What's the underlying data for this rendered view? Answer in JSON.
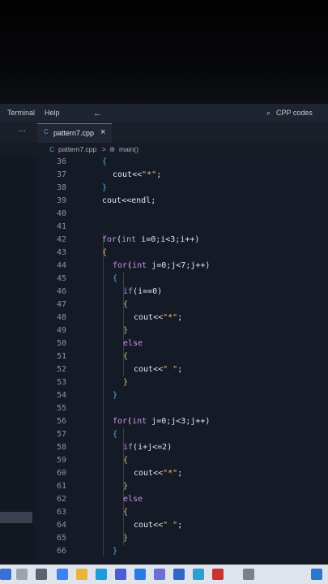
{
  "menu": {
    "terminal": "Terminal",
    "help": "Help",
    "back": "←",
    "search_icon": "⌕",
    "title": "CPP codes"
  },
  "tab": {
    "icon": "C",
    "name": "pattern7.cpp",
    "close": "×",
    "more": "···"
  },
  "breadcrumb": {
    "icon": "C",
    "file": "pattern7.cpp",
    "sep": ">",
    "fn_icon": "⊛",
    "fn": "main()"
  },
  "colors": {
    "keyword": "#c792ea",
    "brace_gold": "#e5c07b",
    "brace_blue": "#5aa9e6",
    "string": "#e5c07b",
    "text": "#e2e6ec",
    "line_number": "#8a93a2",
    "accent": "#3b82f6"
  },
  "lines": [
    {
      "num": "36",
      "indent": 2,
      "tokens": [
        {
          "t": "{",
          "c": "bb"
        }
      ]
    },
    {
      "num": "37",
      "indent": 3,
      "tokens": [
        {
          "t": "cout<<",
          "c": "w"
        },
        {
          "t": "\"*\"",
          "c": "s"
        },
        {
          "t": ";",
          "c": "w"
        }
      ]
    },
    {
      "num": "38",
      "indent": 2,
      "tokens": [
        {
          "t": "}",
          "c": "bb"
        }
      ]
    },
    {
      "num": "39",
      "indent": 2,
      "tokens": [
        {
          "t": "cout<<endl;",
          "c": "w"
        }
      ]
    },
    {
      "num": "40",
      "indent": 0,
      "tokens": []
    },
    {
      "num": "41",
      "indent": 0,
      "tokens": []
    },
    {
      "num": "42",
      "indent": 2,
      "tokens": [
        {
          "t": "for",
          "c": "k"
        },
        {
          "t": "(",
          "c": "w"
        },
        {
          "t": "int",
          "c": "k"
        },
        {
          "t": " i=0;i<3;i++)",
          "c": "w"
        }
      ]
    },
    {
      "num": "43",
      "indent": 2,
      "tokens": [
        {
          "t": "{",
          "c": "by"
        }
      ]
    },
    {
      "num": "44",
      "indent": 3,
      "tokens": [
        {
          "t": "for",
          "c": "k"
        },
        {
          "t": "(",
          "c": "w"
        },
        {
          "t": "int",
          "c": "k"
        },
        {
          "t": " j=0;j<7;j++)",
          "c": "w"
        }
      ]
    },
    {
      "num": "45",
      "indent": 3,
      "tokens": [
        {
          "t": "{",
          "c": "bb"
        }
      ]
    },
    {
      "num": "46",
      "indent": 4,
      "tokens": [
        {
          "t": "if",
          "c": "k"
        },
        {
          "t": "(i==0)",
          "c": "w"
        }
      ]
    },
    {
      "num": "47",
      "indent": 4,
      "tokens": [
        {
          "t": "{",
          "c": "by"
        }
      ]
    },
    {
      "num": "48",
      "indent": 5,
      "tokens": [
        {
          "t": "cout<<",
          "c": "w"
        },
        {
          "t": "\"*\"",
          "c": "s"
        },
        {
          "t": ";",
          "c": "w"
        }
      ]
    },
    {
      "num": "49",
      "indent": 4,
      "tokens": [
        {
          "t": "}",
          "c": "by"
        }
      ]
    },
    {
      "num": "50",
      "indent": 4,
      "tokens": [
        {
          "t": "else",
          "c": "k"
        }
      ]
    },
    {
      "num": "51",
      "indent": 4,
      "tokens": [
        {
          "t": "{",
          "c": "by"
        }
      ]
    },
    {
      "num": "52",
      "indent": 5,
      "tokens": [
        {
          "t": "cout<<",
          "c": "w"
        },
        {
          "t": "\" \"",
          "c": "s"
        },
        {
          "t": ";",
          "c": "w"
        }
      ]
    },
    {
      "num": "53",
      "indent": 4,
      "tokens": [
        {
          "t": "}",
          "c": "by"
        }
      ]
    },
    {
      "num": "54",
      "indent": 3,
      "tokens": [
        {
          "t": "}",
          "c": "bb"
        }
      ]
    },
    {
      "num": "55",
      "indent": 0,
      "tokens": []
    },
    {
      "num": "56",
      "indent": 3,
      "tokens": [
        {
          "t": "for",
          "c": "k"
        },
        {
          "t": "(",
          "c": "w"
        },
        {
          "t": "int",
          "c": "k"
        },
        {
          "t": " j=0;j<3;j++)",
          "c": "w"
        }
      ]
    },
    {
      "num": "57",
      "indent": 3,
      "tokens": [
        {
          "t": "{",
          "c": "bb"
        }
      ]
    },
    {
      "num": "58",
      "indent": 4,
      "tokens": [
        {
          "t": "if",
          "c": "k"
        },
        {
          "t": "(i+j<=2)",
          "c": "w"
        }
      ]
    },
    {
      "num": "59",
      "indent": 4,
      "tokens": [
        {
          "t": "{",
          "c": "by"
        }
      ]
    },
    {
      "num": "60",
      "indent": 5,
      "tokens": [
        {
          "t": "cout<<",
          "c": "w"
        },
        {
          "t": "\"*\"",
          "c": "s"
        },
        {
          "t": ";",
          "c": "w"
        }
      ]
    },
    {
      "num": "61",
      "indent": 4,
      "tokens": [
        {
          "t": "}",
          "c": "by"
        }
      ]
    },
    {
      "num": "62",
      "indent": 4,
      "tokens": [
        {
          "t": "else",
          "c": "k"
        }
      ]
    },
    {
      "num": "63",
      "indent": 4,
      "tokens": [
        {
          "t": "{",
          "c": "by"
        }
      ]
    },
    {
      "num": "64",
      "indent": 5,
      "tokens": [
        {
          "t": "cout<<",
          "c": "w"
        },
        {
          "t": "\" \"",
          "c": "s"
        },
        {
          "t": ";",
          "c": "w"
        }
      ]
    },
    {
      "num": "65",
      "indent": 4,
      "tokens": [
        {
          "t": "}",
          "c": "by"
        }
      ]
    },
    {
      "num": "66",
      "indent": 3,
      "tokens": [
        {
          "t": "}",
          "c": "bb"
        }
      ]
    }
  ],
  "taskbar": [
    {
      "icon": "start-icon",
      "color": "#3a6fd8"
    },
    {
      "icon": "search-icon",
      "color": "#9aa3b0"
    },
    {
      "icon": "task-view-icon",
      "color": "#5b6270"
    },
    {
      "icon": "widgets-icon",
      "color": "#3b82f6"
    },
    {
      "icon": "file-explorer-icon",
      "color": "#e8b53a"
    },
    {
      "icon": "edge-icon",
      "color": "#1f9bd6"
    },
    {
      "icon": "store-icon",
      "color": "#4d5bd8"
    },
    {
      "icon": "mail-icon",
      "color": "#2a7be4"
    },
    {
      "icon": "teams-icon",
      "color": "#6b6fd6"
    },
    {
      "icon": "word-icon",
      "color": "#2f67c9"
    },
    {
      "icon": "photos-icon",
      "color": "#2a9fd6"
    },
    {
      "icon": "media-icon",
      "color": "#c8332f"
    },
    {
      "icon": "settings-icon",
      "color": "#7a808c"
    },
    {
      "icon": "code-icon",
      "color": "#2a78d0"
    }
  ]
}
